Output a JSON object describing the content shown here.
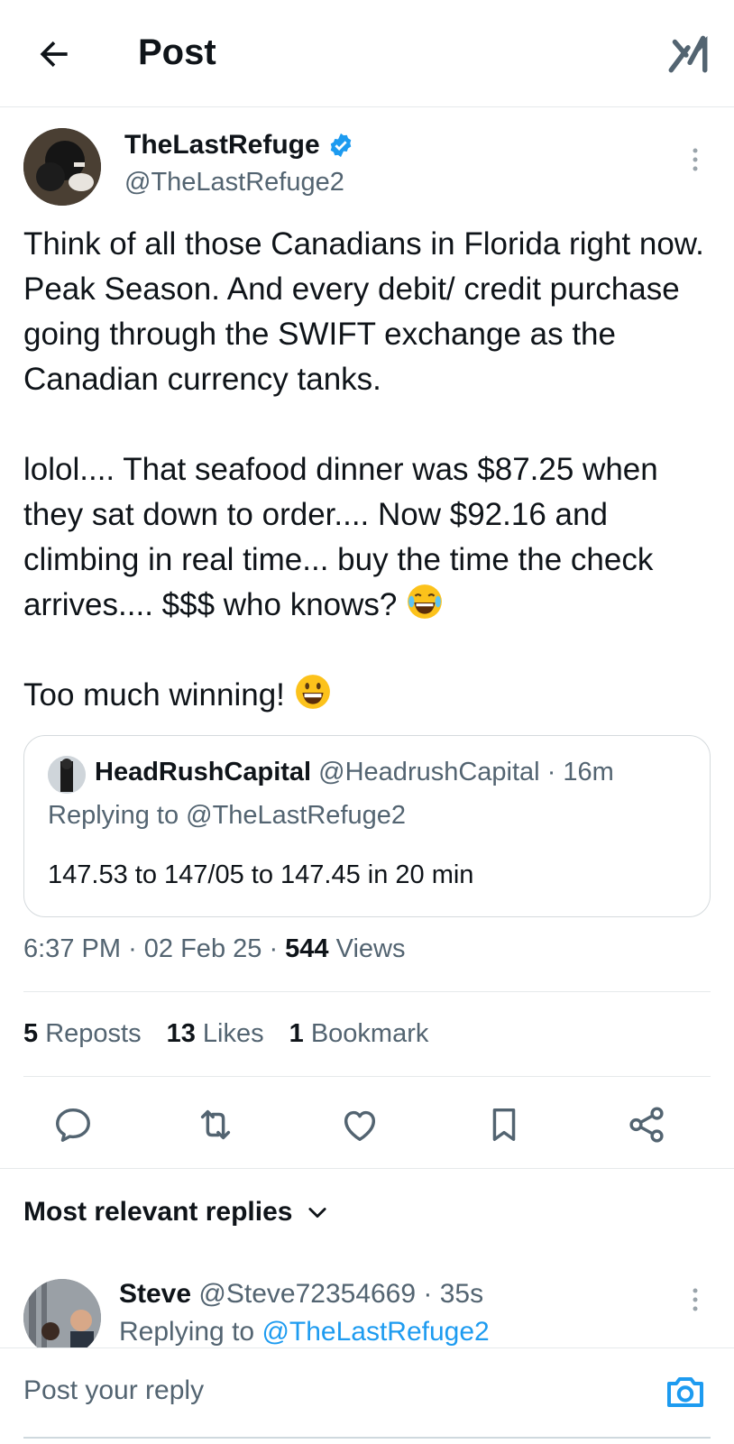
{
  "header": {
    "title": "Post",
    "back_icon": "back-arrow-icon",
    "grok_icon": "grok-icon"
  },
  "post": {
    "author": {
      "name": "TheLastRefuge",
      "handle": "@TheLastRefuge2",
      "verified": true
    },
    "paragraphs": [
      "Think of all those Canadians in Florida right now. Peak Season.  And every debit/ credit purchase going through the SWIFT exchange as the Canadian currency tanks.",
      "lolol....  That seafood dinner was $87.25 when they sat down to order....  Now $92.16 and climbing in real time... buy the time the check arrives....  $$$ who knows?",
      "Too much winning!"
    ],
    "quote": {
      "name": "HeadRushCapital",
      "handle": "@HeadrushCapital",
      "time": "16m",
      "replying_to": "Replying to @TheLastRefuge2",
      "text": "147.53 to 147/05 to 147.45 in 20 min"
    },
    "meta": {
      "time": "6:37 PM",
      "date": "02 Feb 25",
      "views_count": "544",
      "views_label": "Views"
    },
    "stats": {
      "reposts_count": "5",
      "reposts_label": "Reposts",
      "likes_count": "13",
      "likes_label": "Likes",
      "bookmarks_count": "1",
      "bookmarks_label": "Bookmark"
    }
  },
  "actions": [
    "reply-icon",
    "repost-icon",
    "like-icon",
    "bookmark-icon",
    "share-icon"
  ],
  "replies": {
    "sort_label": "Most relevant replies",
    "items": [
      {
        "name": "Steve",
        "handle": "@Steve72354669",
        "time": "35s",
        "replying_prefix": "Replying to",
        "replying_handle": "@TheLastRefuge2"
      }
    ]
  },
  "composer": {
    "placeholder": "Post your reply"
  },
  "colors": {
    "text": "#0f1419",
    "secondary": "#536471",
    "accent": "#1d9bf0",
    "border": "#e6e9eb"
  }
}
